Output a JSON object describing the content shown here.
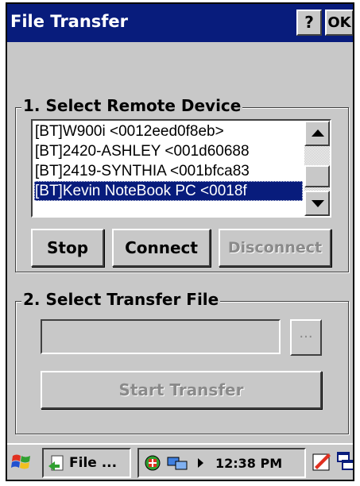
{
  "window": {
    "title": "File Transfer",
    "help_label": "?",
    "ok_label": "OK"
  },
  "section1": {
    "title": "1. Select Remote Device",
    "devices": [
      "[BT]W900i <0012eed0f8eb>",
      "[BT]2420-ASHLEY <001d60688",
      "[BT]2419-SYNTHIA <001bfca83",
      "[BT]Kevin NoteBook PC <0018f"
    ],
    "selected_index": 3,
    "buttons": {
      "stop": "Stop",
      "connect": "Connect",
      "disconnect": "Disconnect"
    }
  },
  "section2": {
    "title": "2. Select Transfer File",
    "file_value": "",
    "browse_label": "...",
    "start_label": "Start Transfer"
  },
  "taskbar": {
    "task_label": "File ...",
    "clock": "12:38 PM"
  },
  "colors": {
    "titlebar": "#081c7c",
    "face": "#c8c8c8",
    "selection": "#081c7c",
    "disabled_text": "#8a8a8a"
  },
  "icons": [
    "help-icon",
    "ok-icon",
    "scroll-up-icon",
    "scroll-down-icon",
    "start-flag-icon",
    "file-transfer-icon",
    "network-icon",
    "connection-icon",
    "tray-arrow-icon",
    "ink-icon",
    "window-switch-icon"
  ]
}
